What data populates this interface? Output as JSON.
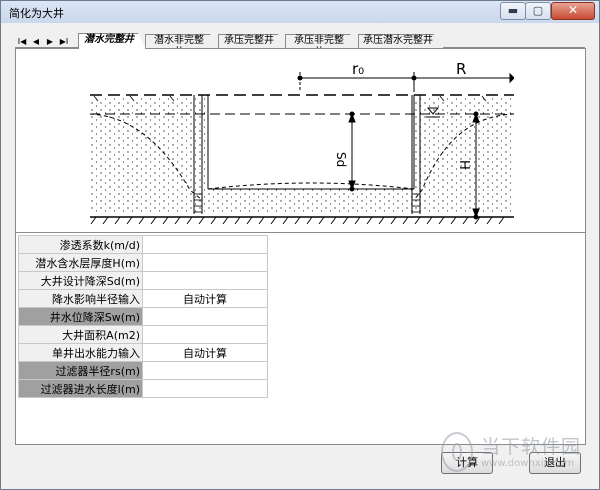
{
  "window": {
    "title": "简化为大井"
  },
  "titlebar_buttons": {
    "minimize": "▬",
    "maximize": "▢",
    "close": "✕"
  },
  "nav": {
    "first": "I◀",
    "prev": "◀",
    "next": "▶",
    "last": "▶I"
  },
  "tabs": [
    {
      "label": "潜水完整井",
      "active": true
    },
    {
      "label": "潜水非完整井",
      "active": false
    },
    {
      "label": "承压完整井",
      "active": false
    },
    {
      "label": "承压非完整井",
      "active": false
    },
    {
      "label": "承压潜水完整井",
      "active": false
    }
  ],
  "diagram": {
    "r0": "r₀",
    "R": "R",
    "Sd": "Sd",
    "H": "H"
  },
  "params": [
    {
      "label": "渗透系数k(m/d)",
      "value": "",
      "highlight": false
    },
    {
      "label": "潜水含水层厚度H(m)",
      "value": "",
      "highlight": false
    },
    {
      "label": "大井设计降深Sd(m)",
      "value": "",
      "highlight": false
    },
    {
      "label": "降水影响半径输入",
      "value": "自动计算",
      "highlight": false
    },
    {
      "label": "井水位降深Sw(m)",
      "value": "",
      "highlight": true
    },
    {
      "label": "大井面积A(m2)",
      "value": "",
      "highlight": false
    },
    {
      "label": "单井出水能力输入",
      "value": "自动计算",
      "highlight": false
    },
    {
      "label": "过滤器半径rs(m)",
      "value": "",
      "highlight": true
    },
    {
      "label": "过滤器进水长度l(m)",
      "value": "",
      "highlight": true
    }
  ],
  "buttons": {
    "calc": "计算",
    "exit": "退出"
  },
  "watermark": {
    "text": "当下软件园",
    "url": "www.downxia.com"
  }
}
